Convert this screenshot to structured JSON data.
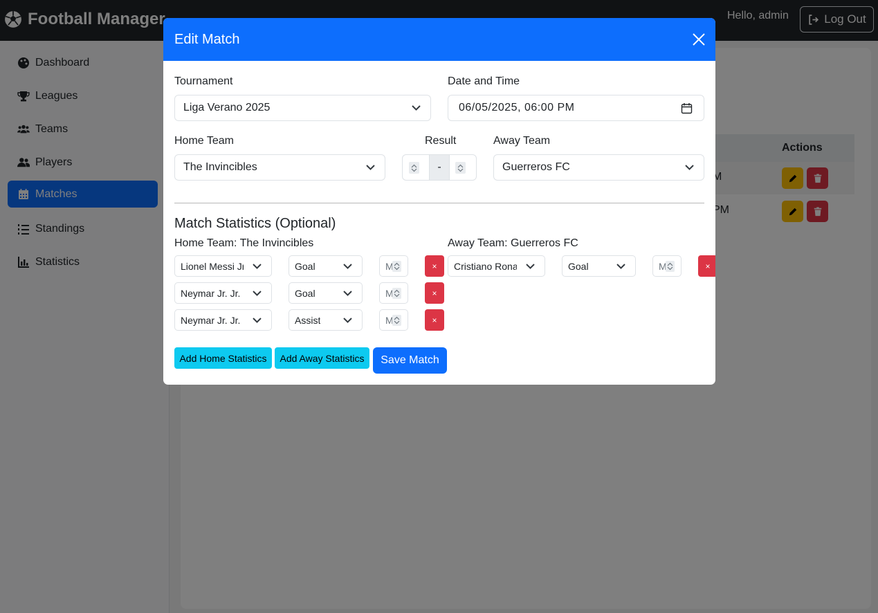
{
  "navbar": {
    "brand": "Football Manager",
    "greeting": "Hello, admin",
    "logout_label": "Log Out"
  },
  "sidebar": {
    "items": [
      {
        "label": "Dashboard",
        "icon": "palette-icon"
      },
      {
        "label": "Leagues",
        "icon": "trophy-icon"
      },
      {
        "label": "Teams",
        "icon": "users-icon"
      },
      {
        "label": "Players",
        "icon": "user-friends-icon"
      },
      {
        "label": "Matches",
        "icon": "calendar-icon",
        "active": true
      },
      {
        "label": "Standings",
        "icon": "list-ol-icon"
      },
      {
        "label": "Statistics",
        "icon": "chart-bar-icon"
      }
    ]
  },
  "background_table": {
    "actions_header": "Actions",
    "row1_fragment": "M",
    "row2_fragment": "PM"
  },
  "modal": {
    "title": "Edit Match",
    "tournament_label": "Tournament",
    "tournament_value": "Liga Verano 2025",
    "datetime_label": "Date and Time",
    "datetime_value": "06/05/2025, 06:00  PM",
    "home_label": "Home Team",
    "home_value": "The Invincibles",
    "result_label": "Result",
    "result_separator": "-",
    "away_label": "Away Team",
    "away_value": "Guerreros FC",
    "stats_title": "Match Statistics (Optional)",
    "home_stats_label": "Home Team: The Invincibles",
    "away_stats_label": "Away Team: Guerreros FC",
    "minute_placeholder": "Min",
    "remove_label": "×",
    "home_stats": [
      {
        "player": "Lionel Messi Jr.",
        "type": "Goal"
      },
      {
        "player": "Neymar Jr. Jr. (#",
        "type": "Goal"
      },
      {
        "player": "Neymar Jr. Jr. (#",
        "type": "Assist"
      }
    ],
    "away_stats": [
      {
        "player": "Cristiano Ronaldo",
        "type": "Goal"
      }
    ],
    "add_home_label": "Add Home Statistics",
    "add_away_label": "Add Away Statistics",
    "save_label": "Save Match"
  },
  "colors": {
    "primary": "#0d6efd",
    "danger": "#dc3545",
    "info": "#0dcaf0",
    "warning": "#ffc107",
    "navbar": "#212529"
  }
}
